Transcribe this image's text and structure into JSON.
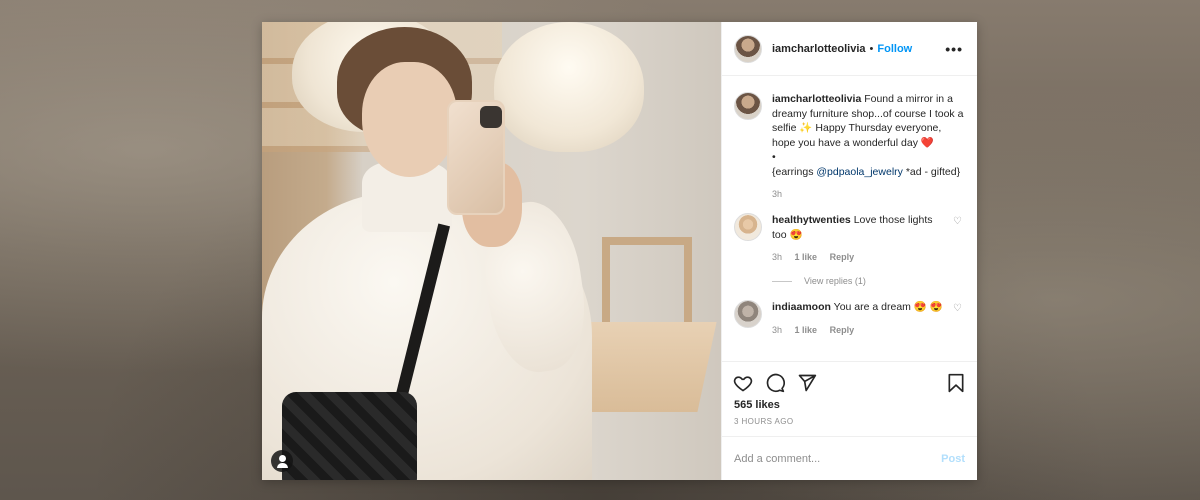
{
  "author": {
    "username": "iamcharlotteolivia",
    "separator": "•",
    "follow_label": "Follow",
    "more_label": "•••"
  },
  "caption": {
    "username": "iamcharlotteolivia",
    "text_1": "Found a mirror in a dreamy furniture shop...of course I took a selfie ✨ Happy Thursday everyone, hope you have a wonderful day ❤️",
    "bullet": "•",
    "text_2_prefix": "{earrings ",
    "mention": "@pdpaola_jewelry",
    "text_2_suffix": " *ad - gifted}",
    "time": "3h"
  },
  "comments": [
    {
      "username": "healthytwenties",
      "text": "Love those lights too 😍",
      "time": "3h",
      "likes": "1 like",
      "reply_label": "Reply",
      "view_replies": "View replies (1)"
    },
    {
      "username": "indiaamoon",
      "text": "You are a dream 😍 😍",
      "time": "3h",
      "likes": "1 like",
      "reply_label": "Reply"
    }
  ],
  "likes": "565 likes",
  "posted_ago": "3 HOURS AGO",
  "add_comment": {
    "placeholder": "Add a comment...",
    "post_label": "Post"
  },
  "icons": {
    "like": "heart-icon",
    "comment": "comment-bubble-icon",
    "share": "paper-plane-icon",
    "save": "bookmark-icon",
    "tag": "user-tag-icon"
  },
  "colors": {
    "link": "#0095f6",
    "text": "#262626",
    "muted": "#8e8e8e",
    "post_disabled": "#b2dffc"
  }
}
